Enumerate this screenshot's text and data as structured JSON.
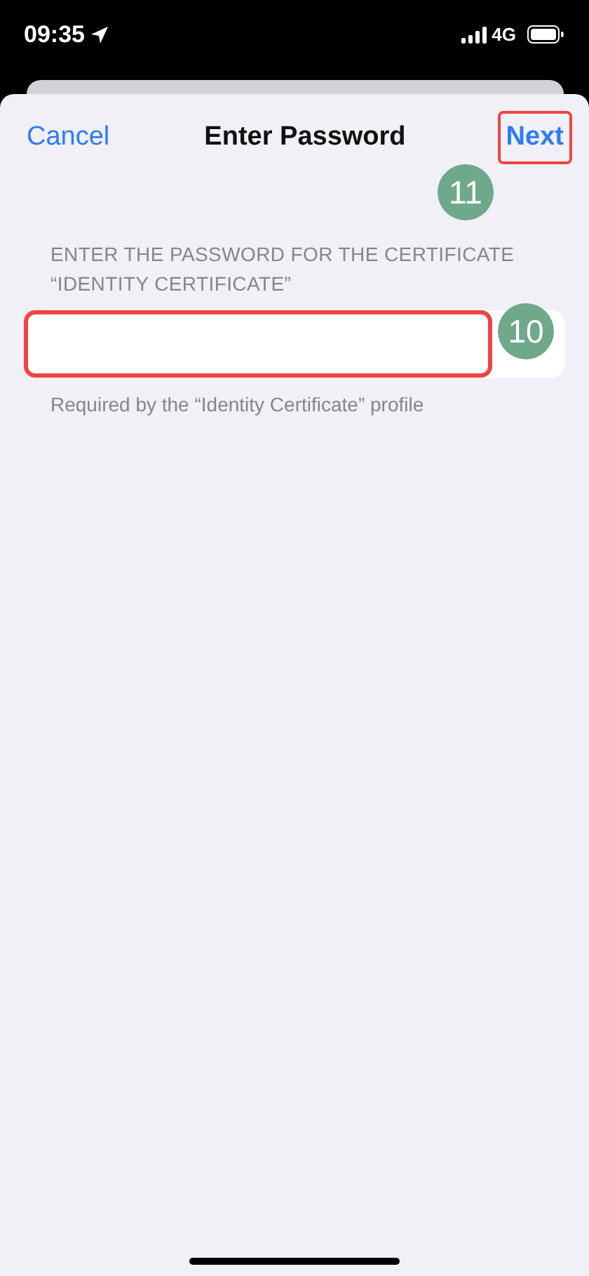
{
  "status_bar": {
    "time": "09:35",
    "network": "4G"
  },
  "nav": {
    "cancel": "Cancel",
    "title": "Enter Password",
    "next": "Next"
  },
  "section_header": "ENTER THE PASSWORD FOR THE CERTIFICATE “IDENTITY CERTIFICATE”",
  "footer": "Required by the “Identity Certificate” profile",
  "annotations": [
    {
      "label": "11"
    },
    {
      "label": "10"
    }
  ]
}
